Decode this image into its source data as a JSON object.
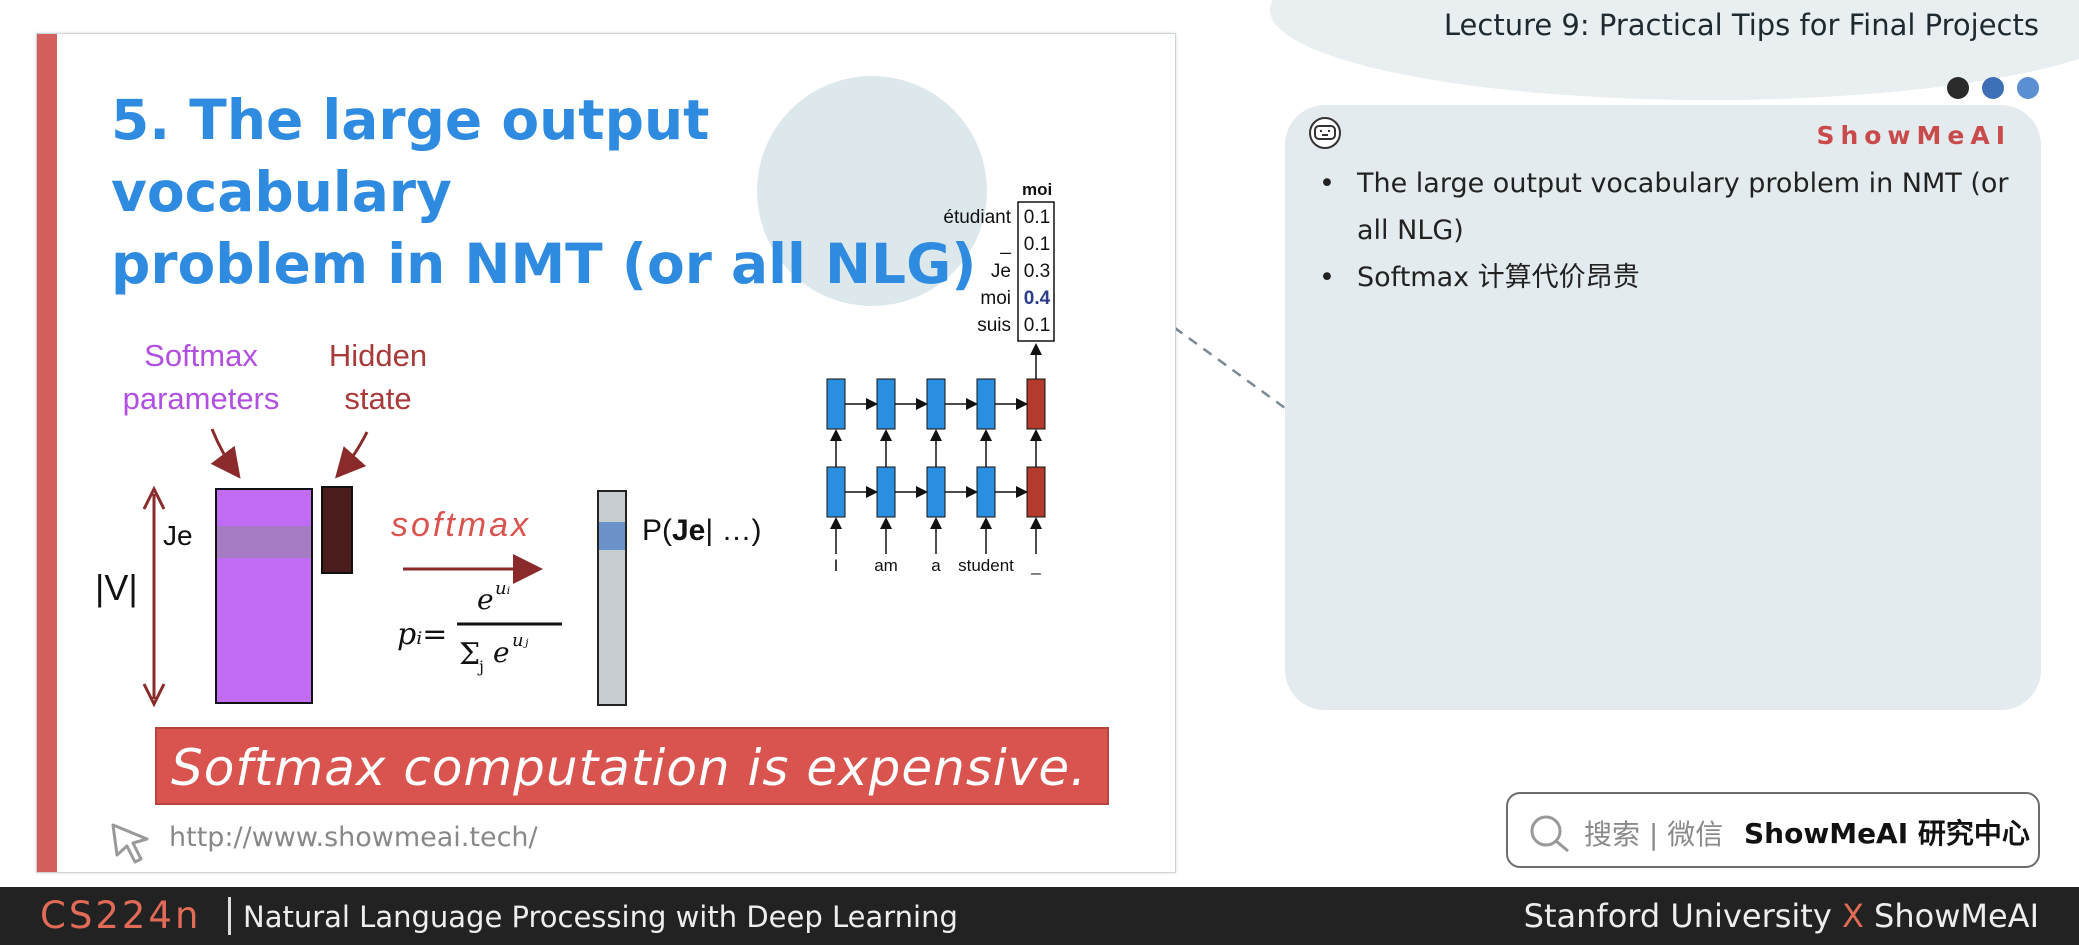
{
  "header": {
    "lecture_title": "Lecture 9: Practical Tips for Final Projects",
    "dot_colors": [
      "#2a2a2a",
      "#3d6fb6",
      "#5b8fd1"
    ]
  },
  "slide": {
    "title_line1": "5. The large output vocabulary",
    "title_line2": "problem in NMT (or all NLG)",
    "softmax_params_line1": "Softmax",
    "softmax_params_line2": "parameters",
    "hidden_state_line1": "Hidden",
    "hidden_state_line2": "state",
    "je_label": "Je",
    "vocab_label": "|V|",
    "softmax_handwritten": "softmax",
    "prob_prefix": "P(",
    "prob_word": "Je",
    "prob_suffix": "| …)",
    "banner": "Softmax computation is expensive.",
    "url": "http://www.showmeai.tech/",
    "rnn_inputs": [
      "I",
      "am",
      "a",
      "student",
      "_"
    ],
    "output_head": "moi",
    "output_probs": [
      {
        "word": "étudiant",
        "value": "0.1"
      },
      {
        "word": "_",
        "value": "0.1"
      },
      {
        "word": "Je",
        "value": "0.3"
      },
      {
        "word": "moi",
        "value": "0.4"
      },
      {
        "word": "suis",
        "value": "0.1"
      }
    ]
  },
  "panel": {
    "brand": "ShowMeAI",
    "bullets": [
      "The large output vocabulary problem in NMT (or all NLG)",
      "Softmax 计算代价昂贵"
    ]
  },
  "search": {
    "text": "搜索 | 微信",
    "brand": "ShowMeAI 研究中心"
  },
  "footer": {
    "course": "CS224n",
    "course_name": "Natural Language Processing with Deep Learning",
    "credit_left": "Stanford University",
    "credit_x": "X",
    "credit_right": "ShowMeAI"
  }
}
